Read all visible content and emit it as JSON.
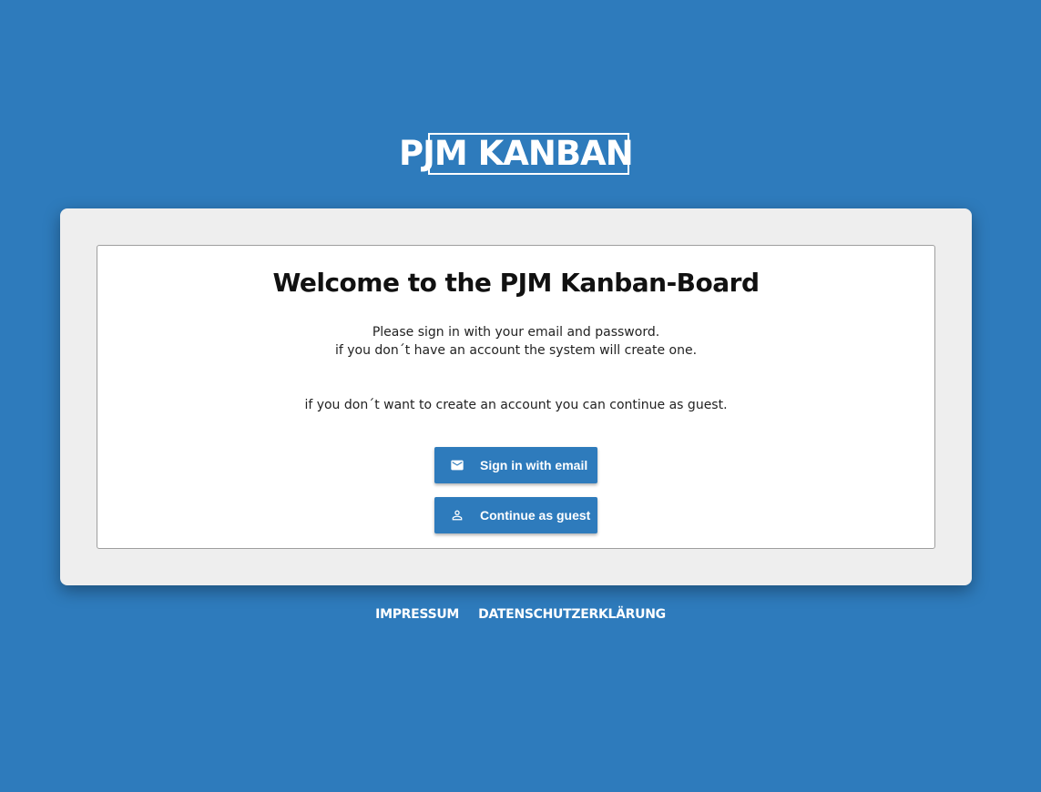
{
  "logo": {
    "text": "PJM KANBAN"
  },
  "card": {
    "title": "Welcome to the PJM Kanban-Board",
    "line1": "Please sign in with your email and password.",
    "line2": "if you don´t have an account the system will create one.",
    "line3": "if you don´t want to create an account you can continue as guest."
  },
  "buttons": {
    "email": {
      "label": "Sign in with email",
      "icon": "mail-icon"
    },
    "guest": {
      "label": "Continue as guest",
      "icon": "person-icon"
    }
  },
  "footer": {
    "links": [
      "IMPRESSUM",
      "DATENSCHUTZERKLÄRUNG"
    ]
  },
  "colors": {
    "background": "#2e7bbc",
    "card": "#eeeeee",
    "panel": "#ffffff",
    "button": "#2e7bbc"
  }
}
